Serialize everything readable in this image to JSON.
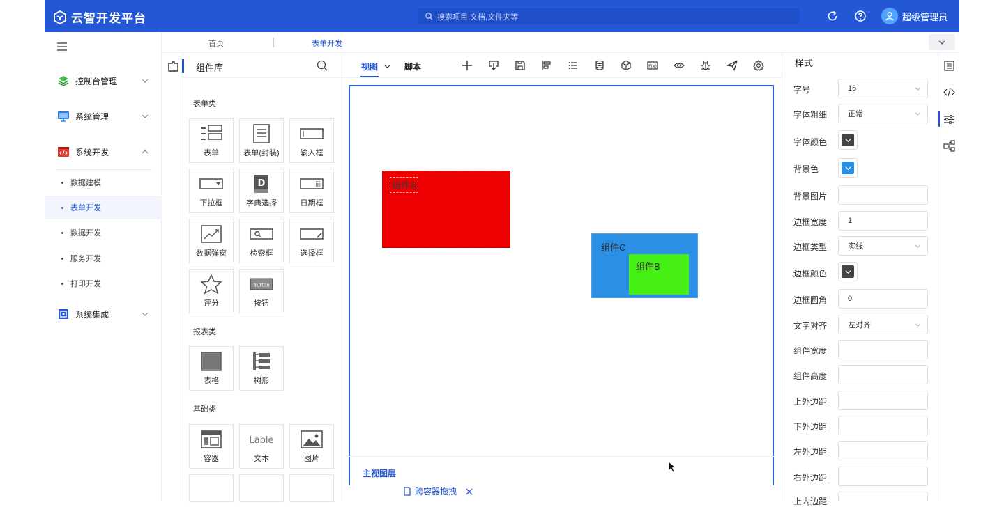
{
  "header": {
    "app_title": "云智开发平台",
    "search_placeholder": "搜索项目,文档,文件夹等",
    "user_name": "超级管理员"
  },
  "nav": {
    "groups": [
      {
        "label": "控制台管理",
        "icon": "layers-icon",
        "expanded": false
      },
      {
        "label": "系统管理",
        "icon": "monitor-icon",
        "expanded": false
      },
      {
        "label": "系统开发",
        "icon": "code-box-icon",
        "expanded": true
      },
      {
        "label": "系统集成",
        "icon": "chip-icon",
        "expanded": false
      }
    ],
    "sub_items": [
      "数据建模",
      "表单开发",
      "数据开发",
      "服务开发",
      "打印开发"
    ],
    "active_sub": "表单开发"
  },
  "tabs": [
    "首页",
    "表单开发"
  ],
  "library": {
    "title": "组件库",
    "categories": [
      {
        "name": "表单类",
        "items": [
          "表单",
          "表单(封装)",
          "输入框",
          "下拉框",
          "字典选择",
          "日期框",
          "数据弹窗",
          "检索框",
          "选择框",
          "评分",
          "按钮"
        ]
      },
      {
        "name": "报表类",
        "items": [
          "表格",
          "树形"
        ]
      },
      {
        "name": "基础类",
        "items": [
          "容器",
          "文本",
          "图片"
        ]
      }
    ],
    "text_card_glyph": "Lable",
    "button_card_glyph": "Button"
  },
  "editor": {
    "tabs": [
      "视图",
      "脚本"
    ],
    "toolbar_icons": [
      "plus-icon",
      "import-icon",
      "save-icon",
      "align-icon",
      "list-icon",
      "database-icon",
      "cube-icon",
      "function-icon",
      "preview-eye-icon",
      "debug-bug-icon",
      "publish-send-icon",
      "settings-icon"
    ],
    "components": [
      {
        "label": "组件A",
        "color": "#ee0000"
      },
      {
        "label": "组件C",
        "color": "#2b8fe6"
      },
      {
        "label": "组件B",
        "color": "#45ee13"
      }
    ],
    "layers_title": "主视图层",
    "cross_drag_label": "跨容器拖拽"
  },
  "props": {
    "title": "样式",
    "fields": [
      {
        "label": "字号",
        "value": "16",
        "type": "select"
      },
      {
        "label": "字体粗细",
        "value": "正常",
        "type": "select"
      },
      {
        "label": "字体颜色",
        "value": "#444444",
        "type": "color"
      },
      {
        "label": "背景色",
        "value": "#2b8fe6",
        "type": "color"
      },
      {
        "label": "背景图片",
        "value": "",
        "type": "input"
      },
      {
        "label": "边框宽度",
        "value": "1",
        "type": "input"
      },
      {
        "label": "边框类型",
        "value": "实线",
        "type": "select"
      },
      {
        "label": "边框颜色",
        "value": "#444444",
        "type": "color"
      },
      {
        "label": "边框圆角",
        "value": "0",
        "type": "input"
      },
      {
        "label": "文字对齐",
        "value": "左对齐",
        "type": "select"
      },
      {
        "label": "组件宽度",
        "value": "",
        "type": "input"
      },
      {
        "label": "组件高度",
        "value": "",
        "type": "input"
      },
      {
        "label": "上外边距",
        "value": "",
        "type": "input"
      },
      {
        "label": "下外边距",
        "value": "",
        "type": "input"
      },
      {
        "label": "左外边距",
        "value": "",
        "type": "input"
      },
      {
        "label": "右外边距",
        "value": "",
        "type": "input"
      },
      {
        "label": "上内边距",
        "value": "",
        "type": "input"
      }
    ]
  },
  "colors": {
    "brand": "#2357d6",
    "accent": "#2f66d8"
  }
}
